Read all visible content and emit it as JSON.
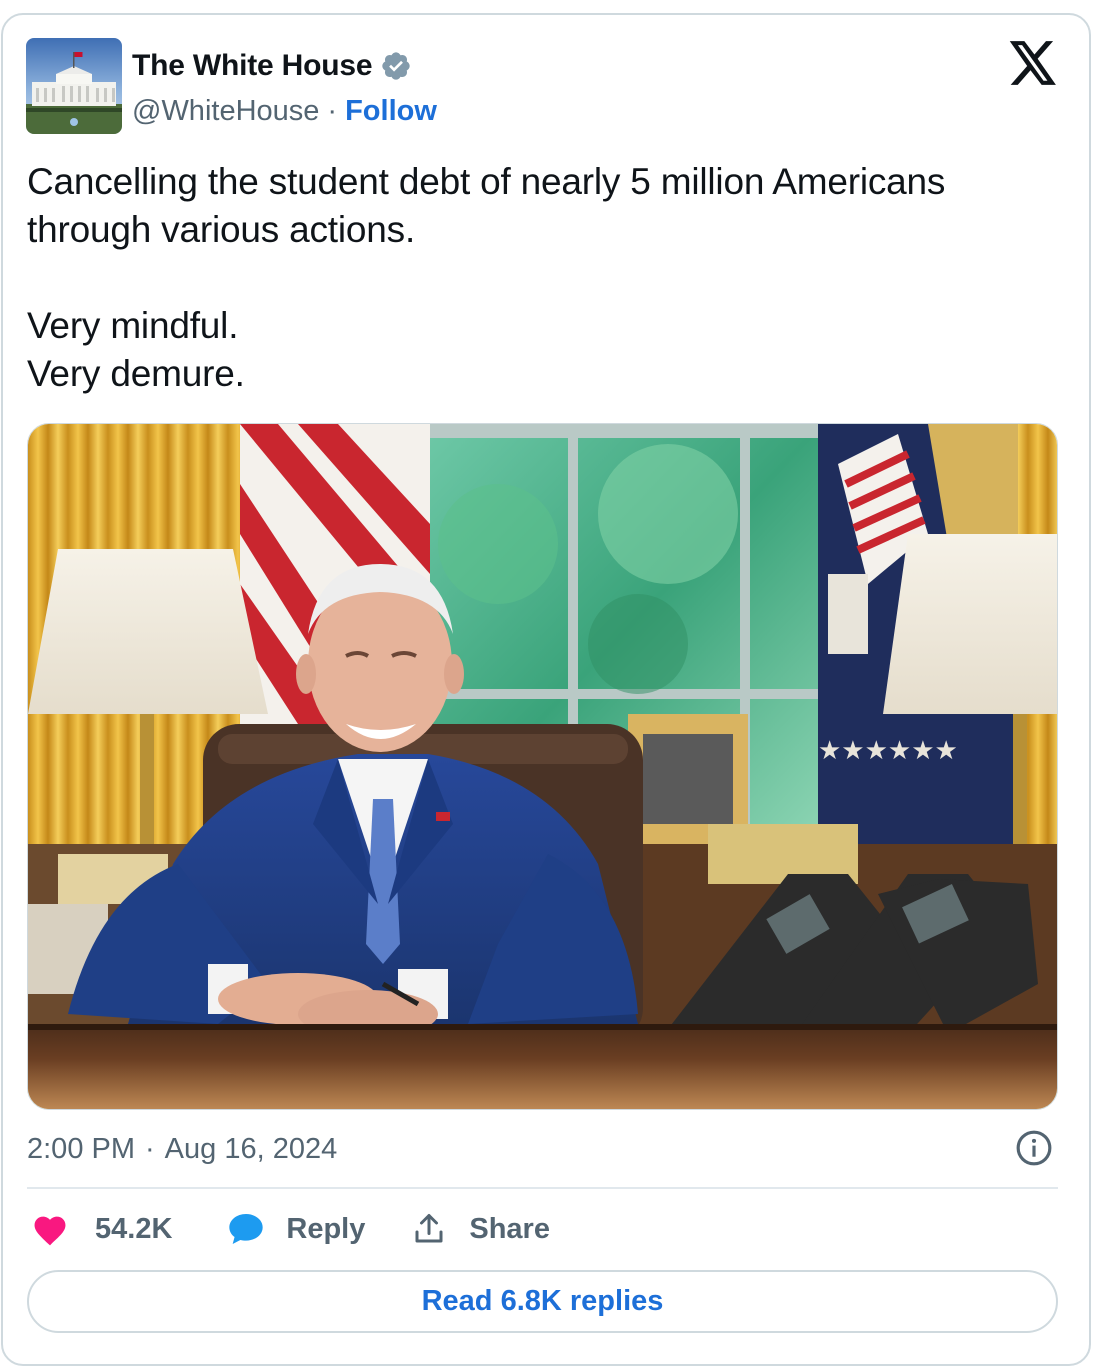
{
  "author": {
    "display_name": "The White House",
    "handle": "@WhiteHouse",
    "separator": "·",
    "follow_label": "Follow",
    "avatar_icon": "white-house-avatar",
    "verified_icon": "verified-badge-icon"
  },
  "platform_icon": "x-logo-icon",
  "tweet": {
    "text": "Cancelling the student debt of nearly 5 million Americans through various actions.\n\nVery mindful.\nVery demure.",
    "media_description_icon": "photo"
  },
  "meta": {
    "time": "2:00 PM",
    "separator": "·",
    "date": "Aug 16, 2024",
    "info_icon": "info-icon"
  },
  "actions": {
    "likes": "54.2K",
    "reply_label": "Reply",
    "share_label": "Share"
  },
  "read_replies_label": "Read 6.8K replies",
  "colors": {
    "link_blue": "#1d6fd8",
    "like_pink": "#f91880",
    "reply_blue": "#1d9bf0",
    "text_secondary": "#536471",
    "border": "#cfd9de"
  }
}
